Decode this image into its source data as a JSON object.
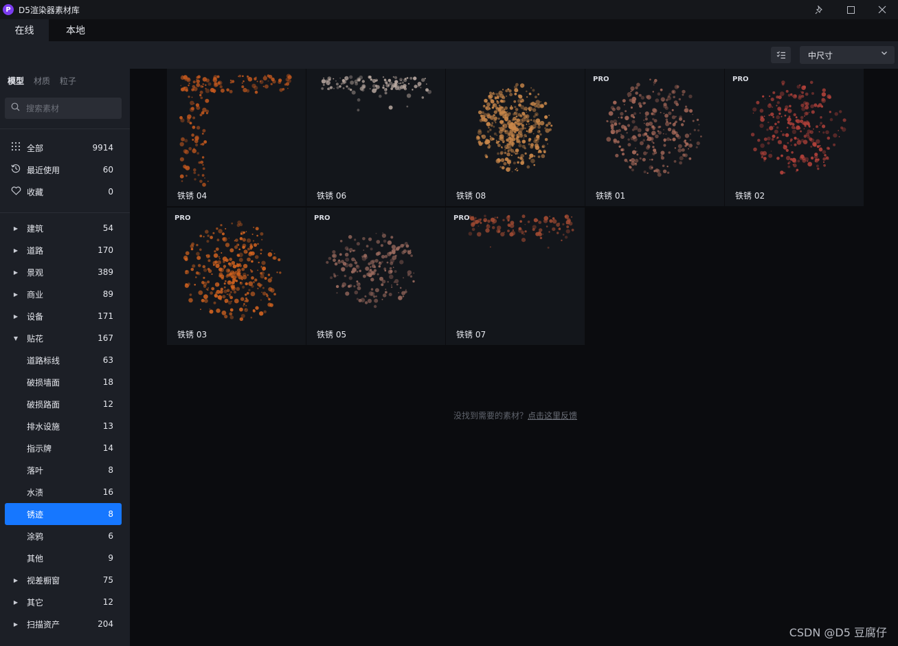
{
  "window": {
    "title": "D5渲染器素材库",
    "logo_glyph": "P",
    "logo_color": "#7b3cf0"
  },
  "tabs": [
    {
      "label": "在线",
      "active": true
    },
    {
      "label": "本地",
      "active": false
    }
  ],
  "toolbar": {
    "filter_icon": "list-filter-icon",
    "size_select_value": "中尺寸"
  },
  "sidebar": {
    "subtabs": [
      {
        "label": "模型",
        "active": true
      },
      {
        "label": "材质",
        "active": false
      },
      {
        "label": "粒子",
        "active": false
      }
    ],
    "search_placeholder": "搜索素材",
    "quick": [
      {
        "label": "全部",
        "count": "9914",
        "icon": "grid-dots-icon"
      },
      {
        "label": "最近使用",
        "count": "60",
        "icon": "history-icon"
      },
      {
        "label": "收藏",
        "count": "0",
        "icon": "heart-icon"
      }
    ],
    "categories": [
      {
        "label": "建筑",
        "count": "54",
        "expanded": false
      },
      {
        "label": "道路",
        "count": "170",
        "expanded": false
      },
      {
        "label": "景观",
        "count": "389",
        "expanded": false
      },
      {
        "label": "商业",
        "count": "89",
        "expanded": false
      },
      {
        "label": "设备",
        "count": "171",
        "expanded": false
      },
      {
        "label": "贴花",
        "count": "167",
        "expanded": true
      }
    ],
    "subcategories": [
      {
        "label": "道路标线",
        "count": "63"
      },
      {
        "label": "破损墙面",
        "count": "18"
      },
      {
        "label": "破损路面",
        "count": "12"
      },
      {
        "label": "排水设施",
        "count": "13"
      },
      {
        "label": "指示牌",
        "count": "14"
      },
      {
        "label": "落叶",
        "count": "8"
      },
      {
        "label": "水渍",
        "count": "16"
      },
      {
        "label": "锈迹",
        "count": "8",
        "selected": true
      },
      {
        "label": "涂鸦",
        "count": "6"
      },
      {
        "label": "其他",
        "count": "9"
      }
    ],
    "categories_after": [
      {
        "label": "视差橱窗",
        "count": "75"
      },
      {
        "label": "其它",
        "count": "12"
      },
      {
        "label": "扫描资产",
        "count": "204"
      }
    ],
    "selected_color": "#1677ff"
  },
  "assets": [
    {
      "name": "铁锈 04",
      "pro": false,
      "tint": "#c85a1e"
    },
    {
      "name": "铁锈 06",
      "pro": false,
      "tint": "#b8a8a0"
    },
    {
      "name": "铁锈 08",
      "pro": false,
      "tint": "#c9874a"
    },
    {
      "name": "铁锈 01",
      "pro": true,
      "tint": "#a86a5a"
    },
    {
      "name": "铁锈 02",
      "pro": true,
      "tint": "#b2413a"
    },
    {
      "name": "铁锈 03",
      "pro": true,
      "tint": "#d0621f"
    },
    {
      "name": "铁锈 05",
      "pro": true,
      "tint": "#9a6a5e"
    },
    {
      "name": "铁锈 07",
      "pro": true,
      "tint": "#a04a32"
    }
  ],
  "pro_label": "PRO",
  "feedback": {
    "text": "没找到需要的素材？",
    "link": "点击这里反馈"
  },
  "watermark": "CSDN @D5 豆腐仔"
}
